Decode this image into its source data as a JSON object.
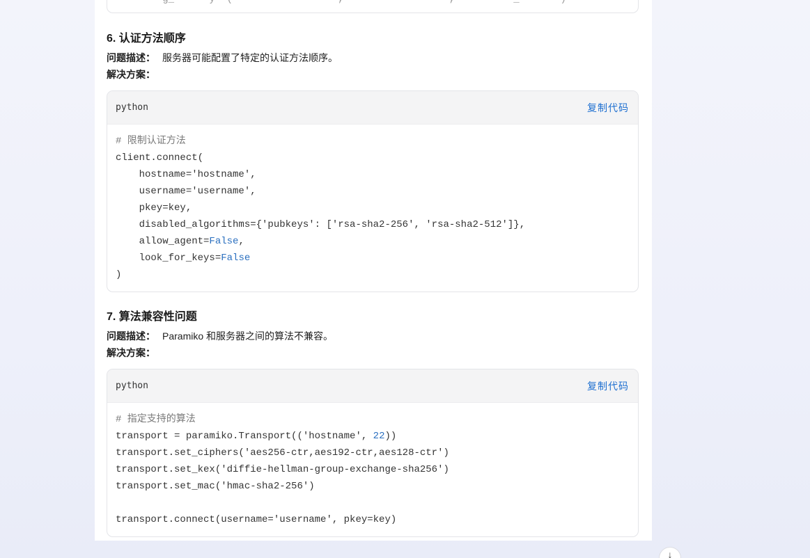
{
  "sections": [
    {
      "title": "6. 认证方法顺序",
      "desc_label": "问题描述",
      "desc_text": "服务器可能配置了特定的认证方法顺序。",
      "solution_label": "解决方案",
      "code": {
        "lang": "python",
        "copy_label": "复制代码",
        "lines": [
          "# 限制认证方法",
          "client.connect(",
          "    hostname='hostname',",
          "    username='username',",
          "    pkey=key,",
          "    disabled_algorithms={'pubkeys': ['rsa-sha2-256', 'rsa-sha2-512']},",
          "    allow_agent=False,",
          "    look_for_keys=False",
          ")"
        ]
      }
    },
    {
      "title": "7. 算法兼容性问题",
      "desc_label": "问题描述",
      "desc_text": "Paramiko 和服务器之间的算法不兼容。",
      "solution_label": "解决方案",
      "code": {
        "lang": "python",
        "copy_label": "复制代码",
        "lines": [
          "# 指定支持的算法",
          "transport = paramiko.Transport(('hostname', 22))",
          "transport.set_ciphers('aes256-ctr,aes192-ctr,aes128-ctr')",
          "transport.set_kex('diffie-hellman-group-exchange-sha256')",
          "transport.set_mac('hmac-sha2-256')",
          "",
          "transport.connect(username='username', pkey=key)"
        ]
      }
    }
  ],
  "prev_code_fragment": "        g_      y  (                  ,                  ,          _       )",
  "scroll_down_icon": "arrow-down-icon",
  "colors": {
    "link": "#1e6fd0",
    "keyword": "#2a6fbf",
    "comment": "#7a7a7a"
  }
}
